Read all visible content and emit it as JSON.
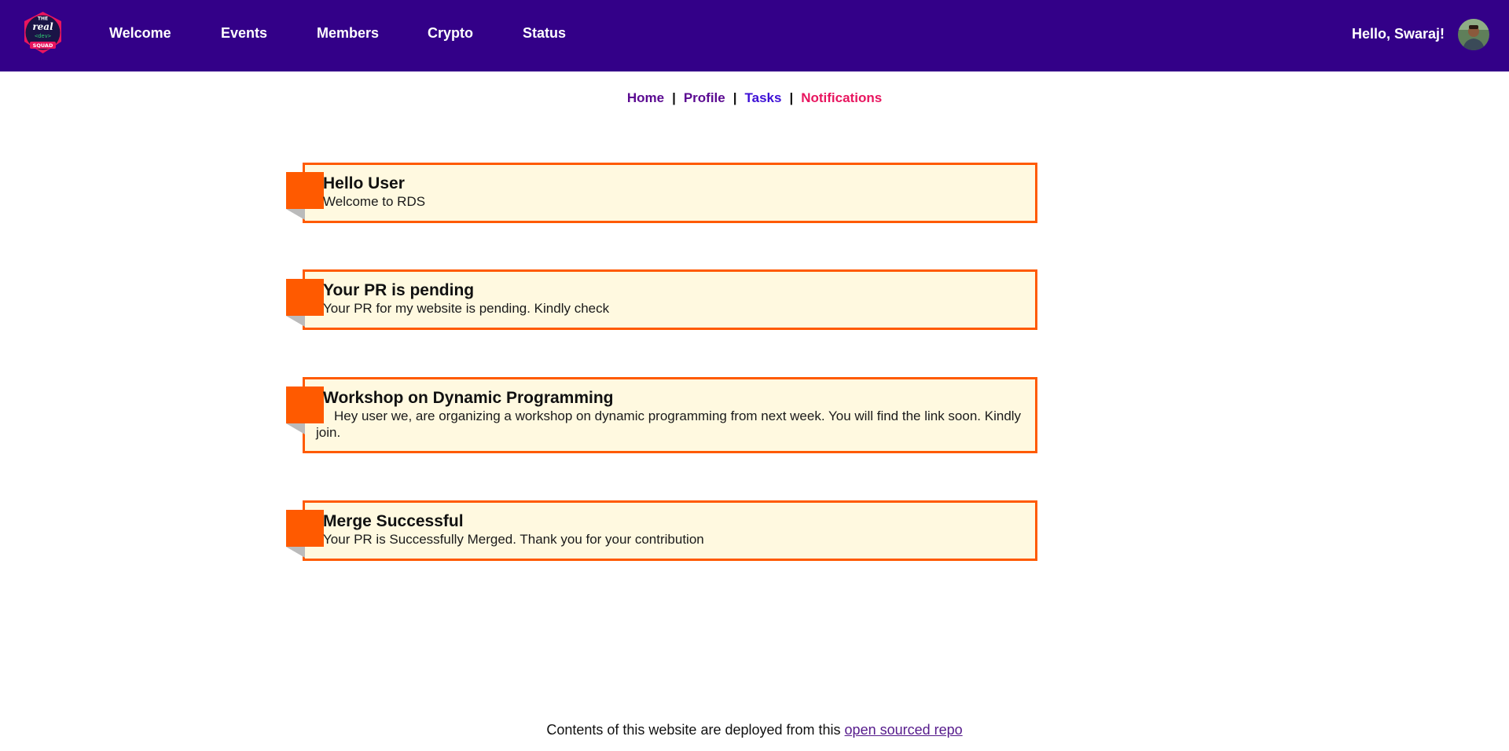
{
  "header": {
    "logo_alt": "The Real Dev Squad",
    "nav": [
      {
        "label": "Welcome"
      },
      {
        "label": "Events"
      },
      {
        "label": "Members"
      },
      {
        "label": "Crypto"
      },
      {
        "label": "Status"
      }
    ],
    "greeting": "Hello, Swaraj!"
  },
  "subnav": {
    "items": [
      {
        "label": "Home",
        "color": "#5b0a91"
      },
      {
        "label": "Profile",
        "color": "#5b0a91"
      },
      {
        "label": "Tasks",
        "color": "#3d0fd6"
      },
      {
        "label": "Notifications",
        "color": "#e8155f"
      }
    ],
    "separator": "|"
  },
  "notifications": [
    {
      "title": "Hello User",
      "body": "Welcome to RDS"
    },
    {
      "title": "Your PR is pending",
      "body": "Your PR for my website is pending. Kindly check"
    },
    {
      "title": "Workshop on Dynamic Programming",
      "body": "Hey user we, are organizing a workshop on dynamic programming from next week. You will find the link soon. Kindly join."
    },
    {
      "title": "Merge Successful",
      "body": "Your PR is Successfully Merged. Thank you for your contribution"
    }
  ],
  "footer": {
    "text": "Contents of this website are deployed from this ",
    "link_label": "open sourced repo"
  },
  "colors": {
    "header_bg": "#330088",
    "card_bg": "#fff9e0",
    "card_accent": "#ff5a00"
  }
}
